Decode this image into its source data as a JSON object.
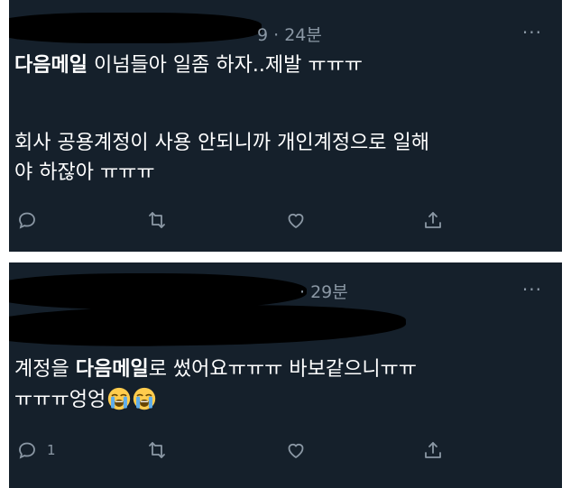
{
  "tweets": [
    {
      "time": "9 · 24분",
      "more": "···",
      "bold_start": "다음메일",
      "line1_rest": " 이넘들아 일좀 하자..제발 ㅠㅠㅠ",
      "paragraph2": "회사 공용계정이 사용 안되니까 개인계정으로 일해\n야 하잖아 ㅠㅠㅠ",
      "reply_count": "",
      "icons": [
        "reply-icon",
        "retweet-icon",
        "like-icon",
        "share-icon"
      ]
    },
    {
      "time": "· 29분",
      "more": "···",
      "prefix": "계정을 ",
      "bold": "다음메일",
      "line1_rest": "로 썼어요ㅠㅠㅠ 바보같으니ㅠㅠ",
      "line2": "ㅠㅠㅠ엉엉",
      "emoji": [
        "loudly-crying-face-icon",
        "loudly-crying-face-icon"
      ],
      "reply_count": "1",
      "icons": [
        "reply-icon",
        "retweet-icon",
        "like-icon",
        "share-icon"
      ]
    }
  ],
  "colors": {
    "background": "#15202b",
    "muted": "#8b98a5",
    "text": "#ffffff"
  }
}
